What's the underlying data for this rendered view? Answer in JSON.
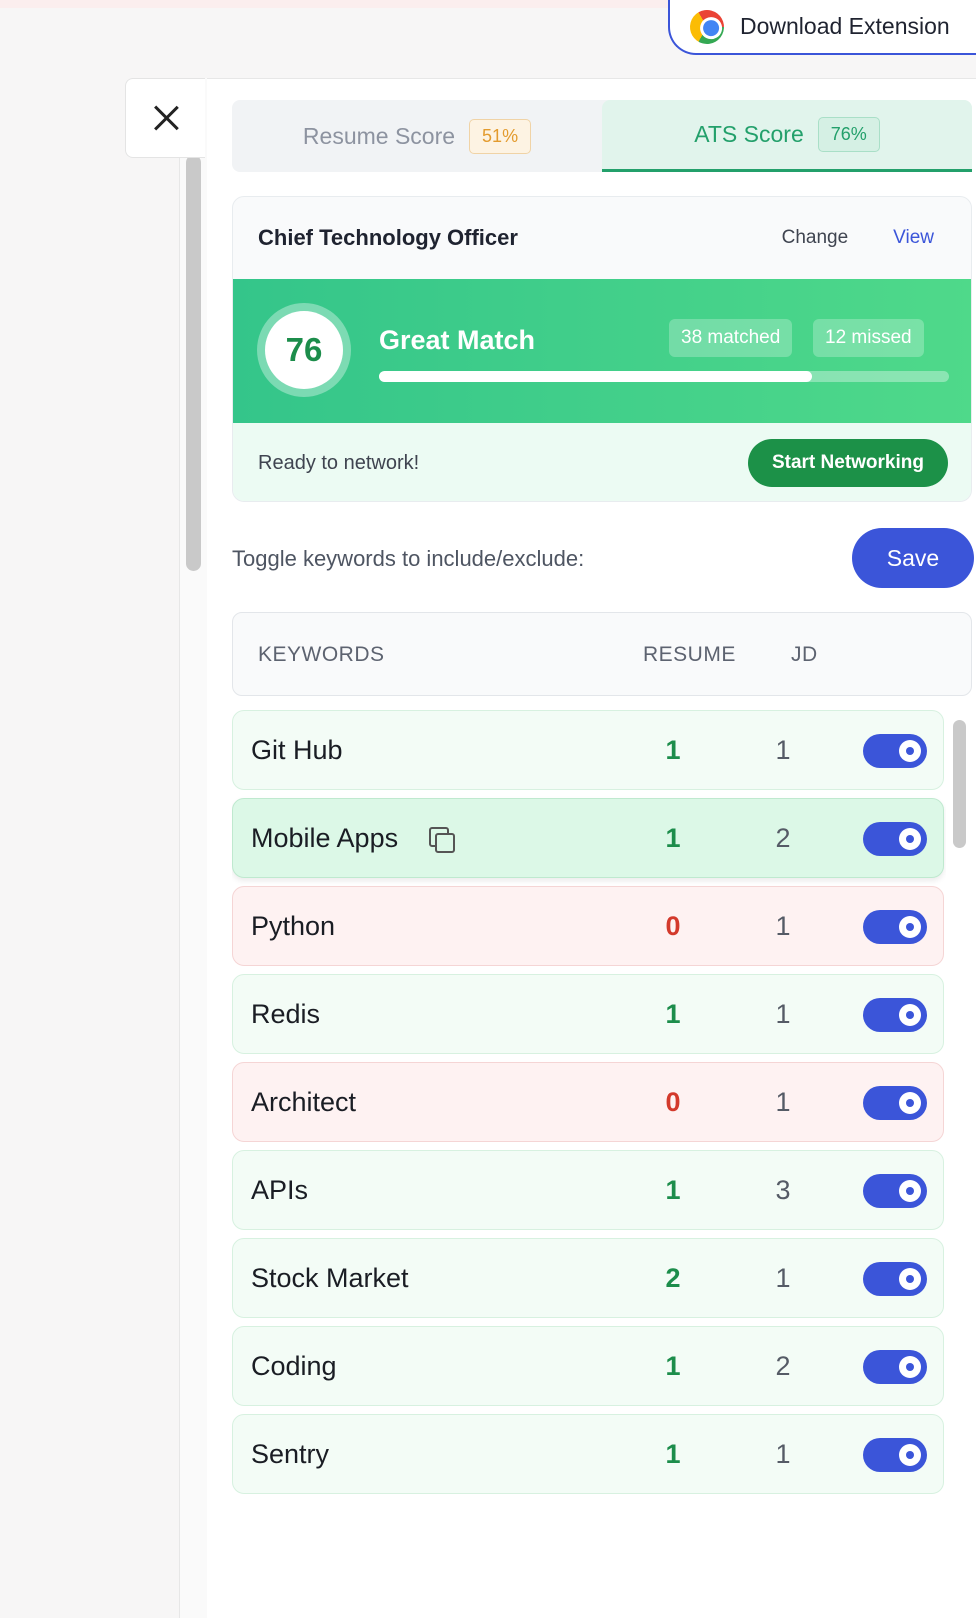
{
  "extension": {
    "label": "Download Extension",
    "icon": "chrome-icon"
  },
  "close": {
    "icon": "close-icon"
  },
  "tabs": [
    {
      "label": "Resume Score",
      "badge": "51%",
      "active": false
    },
    {
      "label": "ATS Score",
      "badge": "76%",
      "active": true
    }
  ],
  "job": {
    "title": "Chief Technology Officer",
    "change_label": "Change",
    "view_label": "View"
  },
  "match": {
    "score": "76",
    "label": "Great Match",
    "matched": "38 matched",
    "missed": "12 missed",
    "progress_fraction": 0.76
  },
  "network": {
    "message": "Ready to network!",
    "button_label": "Start Networking"
  },
  "keywords_toolbar": {
    "hint": "Toggle keywords to include/exclude:",
    "save_label": "Save"
  },
  "table": {
    "headers": {
      "keywords": "KEYWORDS",
      "resume": "RESUME",
      "jd": "JD"
    },
    "rows": [
      {
        "keyword": "Git Hub",
        "resume": "1",
        "jd": "1",
        "enabled": true
      },
      {
        "keyword": "Mobile Apps",
        "resume": "1",
        "jd": "2",
        "enabled": true
      },
      {
        "keyword": "Python",
        "resume": "0",
        "jd": "1",
        "enabled": true
      },
      {
        "keyword": "Redis",
        "resume": "1",
        "jd": "1",
        "enabled": true
      },
      {
        "keyword": "Architect",
        "resume": "0",
        "jd": "1",
        "enabled": true
      },
      {
        "keyword": "APIs",
        "resume": "1",
        "jd": "3",
        "enabled": true
      },
      {
        "keyword": "Stock Market",
        "resume": "2",
        "jd": "1",
        "enabled": true
      },
      {
        "keyword": "Coding",
        "resume": "1",
        "jd": "2",
        "enabled": true
      },
      {
        "keyword": "Sentry",
        "resume": "1",
        "jd": "1",
        "enabled": true
      }
    ]
  },
  "colors": {
    "accent": "#3b55d9",
    "match_green": "#1c8d4b",
    "miss_red": "#d33a2c",
    "ats_green": "#23a06b",
    "resume_orange": "#e39b2e"
  }
}
